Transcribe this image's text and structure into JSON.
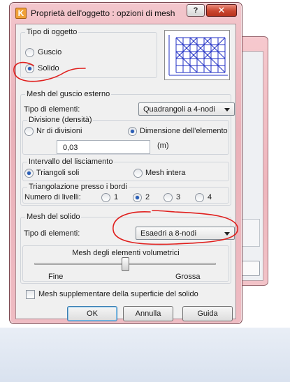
{
  "dialog": {
    "title": "Proprietà dell'oggetto : opzioni di mesh",
    "help_label": "?",
    "close_label": "✕",
    "accent": "#2a5fb8"
  },
  "object_type": {
    "title": "Tipo di oggetto",
    "options": [
      {
        "label": "Guscio",
        "selected": false
      },
      {
        "label": "Solido",
        "selected": true
      }
    ]
  },
  "outer_shell": {
    "title": "Mesh del guscio esterno",
    "element_type_label": "Tipo di elementi:",
    "element_type_value": "Quadrangoli a 4-nodi",
    "division": {
      "title": "Divisione (densità)",
      "options": [
        {
          "label": "Nr di divisioni",
          "selected": false
        },
        {
          "label": "Dimensione dell'elemento",
          "selected": true
        }
      ],
      "value": "0,03",
      "unit": "(m)"
    },
    "smoothing": {
      "title": "Intervallo del lisciamento",
      "options": [
        {
          "label": "Triangoli soli",
          "selected": true
        },
        {
          "label": "Mesh intera",
          "selected": false
        }
      ]
    },
    "border_triangulation": {
      "title": "Triangolazione presso i bordi",
      "levels_label": "Numero di livelli:",
      "options": [
        {
          "label": "1",
          "selected": false
        },
        {
          "label": "2",
          "selected": true
        },
        {
          "label": "3",
          "selected": false
        },
        {
          "label": "4",
          "selected": false
        }
      ]
    }
  },
  "solid_mesh": {
    "title": "Mesh del solido",
    "element_type_label": "Tipo di elementi:",
    "element_type_value": "Esaedri a 8-nodi",
    "volume_title": "Mesh degli elementi volumetrici",
    "slider_min_label": "Fine",
    "slider_max_label": "Grossa",
    "slider_value": 0.5
  },
  "extra": {
    "checkbox_label": "Mesh supplementare della superficie del solido",
    "checked": false
  },
  "buttons": {
    "ok": "OK",
    "cancel": "Annulla",
    "help": "Guida"
  }
}
